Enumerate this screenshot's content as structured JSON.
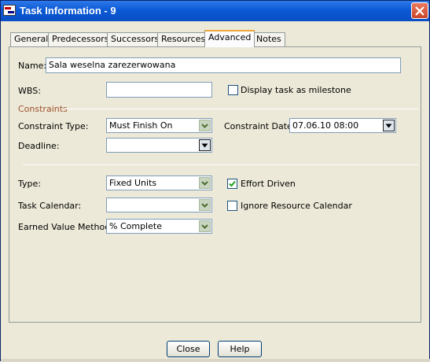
{
  "window": {
    "title": "Task Information - 9",
    "close_icon": "close-icon"
  },
  "tabs": [
    {
      "label": "General",
      "active": false
    },
    {
      "label": "Predecessors",
      "active": false
    },
    {
      "label": "Successors",
      "active": false
    },
    {
      "label": "Resources",
      "active": false
    },
    {
      "label": "Advanced",
      "active": true
    },
    {
      "label": "Notes",
      "active": false
    }
  ],
  "form": {
    "name_label": "Name:",
    "name_value": "Sala weselna zarezerwowana",
    "wbs_label": "WBS:",
    "wbs_value": "",
    "milestone_label": "Display task as milestone",
    "milestone_checked": false,
    "constraints_heading": "Constraints",
    "constraint_type_label": "Constraint Type:",
    "constraint_type_value": "Must Finish On",
    "constraint_date_label": "Constraint Date:",
    "constraint_date_value": "07.06.10 08:00",
    "deadline_label": "Deadline:",
    "deadline_value": "",
    "type_label": "Type:",
    "type_value": "Fixed Units",
    "effort_driven_label": "Effort Driven",
    "effort_driven_checked": true,
    "task_calendar_label": "Task Calendar:",
    "task_calendar_value": "",
    "ignore_calendar_label": "Ignore Resource Calendar",
    "ignore_calendar_checked": false,
    "evm_label": "Earned Value Method:",
    "evm_value": "% Complete"
  },
  "buttons": {
    "close_label": "Close",
    "help_label": "Help"
  },
  "colors": {
    "titlebar": "#0b59d6",
    "dialog_bg": "#ece9d8",
    "active_tab_accent": "#f1a73a",
    "section_label": "#a0522d"
  }
}
